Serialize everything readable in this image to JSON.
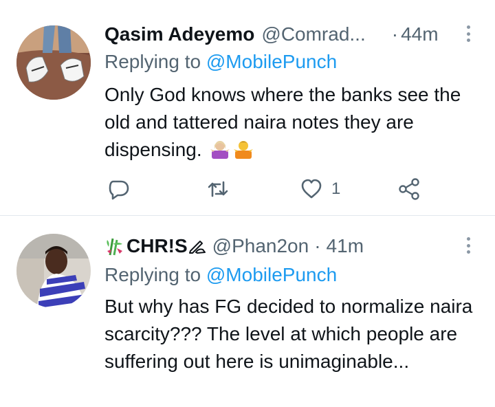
{
  "tweets": [
    {
      "display_name": "Qasim Adeyemo",
      "handle": "@Comrad...",
      "separator": "·",
      "time": "44m",
      "replying_prefix": "Replying to ",
      "replying_to": "@MobilePunch",
      "text": "Only God knows where the banks see the old and tattered naira notes they are dispensing.",
      "emojis": [
        "woman-shrugging-icon",
        "person-shrugging-icon"
      ],
      "likes": "1",
      "actions": [
        "reply-icon",
        "retweet-icon",
        "like-icon",
        "share-icon"
      ]
    },
    {
      "display_name": "CHR!S",
      "name_emoji_left": "bamboo-icon",
      "name_emoji_right": "writing-hand-icon",
      "handle": "@Phan2on",
      "separator": "·",
      "time": "41m",
      "replying_prefix": "Replying to ",
      "replying_to": "@MobilePunch",
      "text": "But why has FG decided to normalize naira scarcity??? The level at which people are suffering out here is unimaginable..."
    }
  ],
  "colors": {
    "text": "#0f1419",
    "muted": "#536471",
    "link": "#1d9bf0",
    "divider": "#e1e8ed",
    "icon": "#536471"
  }
}
